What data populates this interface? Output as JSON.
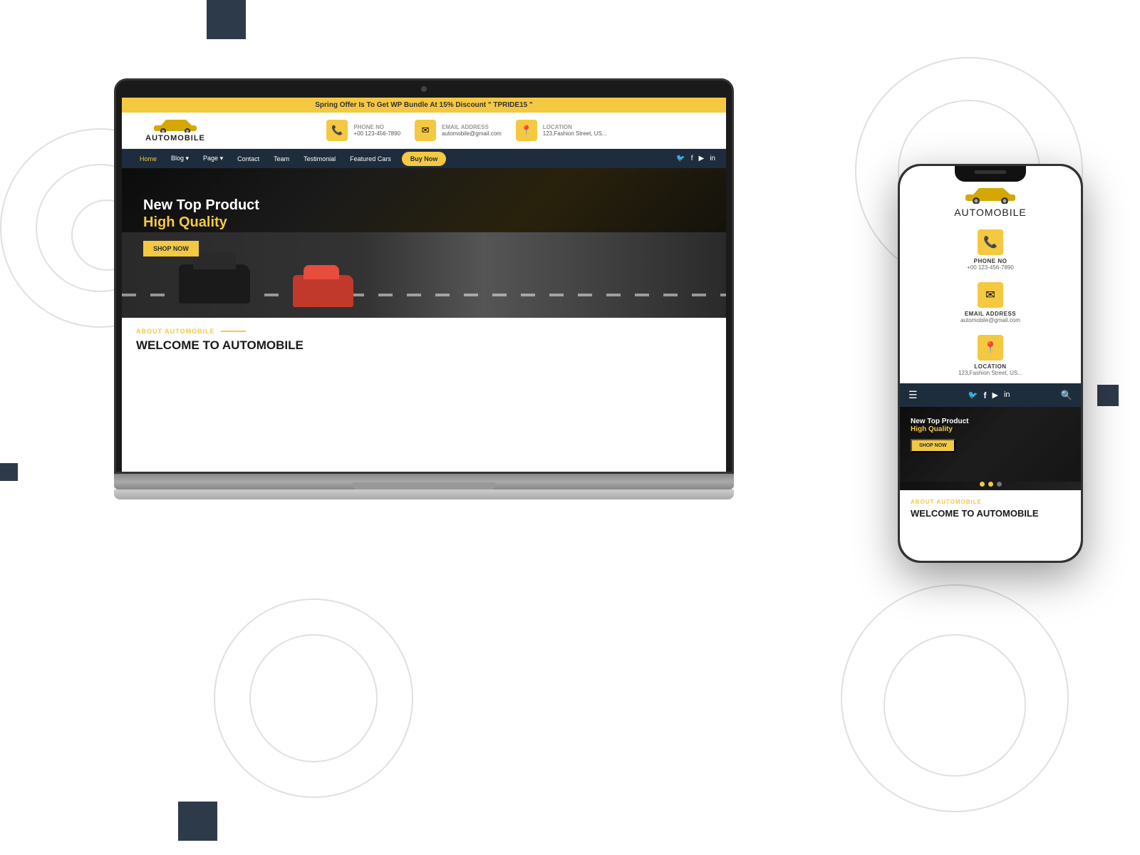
{
  "background": {
    "color": "#ffffff"
  },
  "site": {
    "banner": "Spring Offer Is To Get WP Bundle At 15% Discount \" TPRIDE15 \"",
    "logo": {
      "text_auto": "AUTO",
      "text_mobile": "MOBILE"
    },
    "contact": {
      "phone": {
        "label": "PHONE NO",
        "value": "+00 123-456-7890",
        "icon": "📞"
      },
      "email": {
        "label": "EMAIL ADDRESS",
        "value": "automobile@gmail.com",
        "icon": "✉"
      },
      "location": {
        "label": "LOCATION",
        "value": "123,Fashion Street, US...",
        "icon": "📍"
      }
    },
    "nav": {
      "items": [
        "Home",
        "Blog",
        "Page",
        "Contact",
        "Team",
        "Testimonial",
        "Featured Cars"
      ],
      "cta": "Buy Now",
      "social": [
        "🐦",
        "f",
        "▶",
        "in"
      ]
    },
    "hero": {
      "line1": "New Top Product",
      "line2_prefix": "High ",
      "line2_highlight": "Quality",
      "cta": "SHOP NOW"
    },
    "about": {
      "tag": "ABOUT AUTOMOBILE",
      "title": "WELCOME TO AUTOMOBILE"
    }
  }
}
